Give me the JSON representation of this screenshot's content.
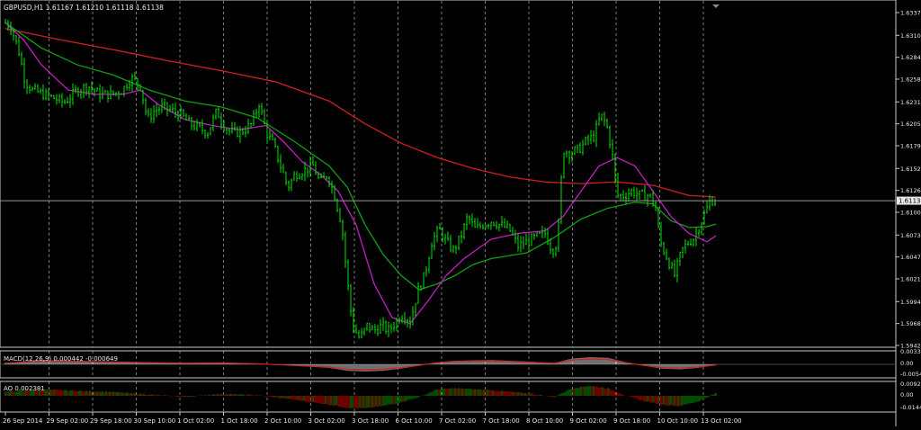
{
  "symbol_header": "GBPUSD,H1  1.61167 1.61210 1.61118 1.61138",
  "price": {
    "current": "1.61138",
    "ticks": [
      {
        "value": 1.6337,
        "label": "1.63370"
      },
      {
        "value": 1.631,
        "label": "1.63100"
      },
      {
        "value": 1.6284,
        "label": "1.62845"
      },
      {
        "value": 1.6258,
        "label": "1.62580"
      },
      {
        "value": 1.6231,
        "label": "1.62310"
      },
      {
        "value": 1.6205,
        "label": "1.62055"
      },
      {
        "value": 1.6179,
        "label": "1.61790"
      },
      {
        "value": 1.6152,
        "label": "1.61525"
      },
      {
        "value": 1.6126,
        "label": "1.61265"
      },
      {
        "value": 1.61,
        "label": "1.61000"
      },
      {
        "value": 1.6073,
        "label": "1.60735"
      },
      {
        "value": 1.6047,
        "label": "1.60470"
      },
      {
        "value": 1.6021,
        "label": "1.60210"
      },
      {
        "value": 1.5994,
        "label": "1.59945"
      },
      {
        "value": 1.5968,
        "label": "1.59680"
      },
      {
        "value": 1.5942,
        "label": "1.59420"
      }
    ]
  },
  "macd": {
    "label": "MACD(12,26,9) 0.000442 -0.000649",
    "ticks": [
      "0.00338",
      "0.00",
      "-0.00546"
    ]
  },
  "ao": {
    "label": "AO 0.002381",
    "ticks": [
      "0.00924",
      "0.00",
      "-0.01449"
    ]
  },
  "time_labels": [
    "26 Sep 2014",
    "29 Sep 02:00",
    "29 Sep 18:00",
    "30 Sep 10:00",
    "1 Oct 02:00",
    "1 Oct 18:00",
    "2 Oct 10:00",
    "3 Oct 02:00",
    "3 Oct 18:00",
    "6 Oct 10:00",
    "7 Oct 02:00",
    "7 Oct 18:00",
    "8 Oct 10:00",
    "9 Oct 02:00",
    "9 Oct 18:00",
    "10 Oct 10:00",
    "13 Oct 02:00"
  ],
  "colors": {
    "background": "#000000",
    "grid": "#c8c8c8",
    "bull": "#00e000",
    "bear": "#00e000",
    "ma_slow": "#d02020",
    "ma_mid": "#10a010",
    "ma_fast": "#c020c0",
    "hist_pos": "#009900",
    "hist_neg": "#dd0000",
    "macd_hist": "#e0e0e0"
  },
  "path_points": [
    [
      0,
      1.6325
    ],
    [
      6,
      1.632
    ],
    [
      14,
      1.6295
    ],
    [
      22,
      1.6255
    ],
    [
      30,
      1.6245
    ],
    [
      42,
      1.624
    ],
    [
      55,
      1.6235
    ],
    [
      65,
      1.623
    ],
    [
      80,
      1.6245
    ],
    [
      92,
      1.625
    ],
    [
      104,
      1.624
    ],
    [
      118,
      1.624
    ],
    [
      130,
      1.6245
    ],
    [
      140,
      1.626
    ],
    [
      150,
      1.625
    ],
    [
      158,
      1.621
    ],
    [
      165,
      1.622
    ],
    [
      175,
      1.6225
    ],
    [
      186,
      1.622
    ],
    [
      196,
      1.6215
    ],
    [
      205,
      1.6205
    ],
    [
      215,
      1.62
    ],
    [
      225,
      1.6195
    ],
    [
      235,
      1.622
    ],
    [
      242,
      1.6205
    ],
    [
      250,
      1.6195
    ],
    [
      262,
      1.6195
    ],
    [
      274,
      1.6205
    ],
    [
      282,
      1.623
    ],
    [
      290,
      1.6195
    ],
    [
      298,
      1.618
    ],
    [
      306,
      1.6155
    ],
    [
      314,
      1.613
    ],
    [
      322,
      1.6145
    ],
    [
      332,
      1.615
    ],
    [
      342,
      1.6155
    ],
    [
      350,
      1.6135
    ],
    [
      358,
      1.6145
    ],
    [
      366,
      1.612
    ],
    [
      374,
      1.6085
    ],
    [
      380,
      1.602
    ],
    [
      386,
      1.5965
    ],
    [
      394,
      1.595
    ],
    [
      402,
      1.5965
    ],
    [
      410,
      1.596
    ],
    [
      418,
      1.5965
    ],
    [
      426,
      1.596
    ],
    [
      434,
      1.597
    ],
    [
      442,
      1.598
    ],
    [
      450,
      1.597
    ],
    [
      458,
      1.6005
    ],
    [
      466,
      1.6025
    ],
    [
      474,
      1.6065
    ],
    [
      482,
      1.608
    ],
    [
      490,
      1.6065
    ],
    [
      498,
      1.6055
    ],
    [
      506,
      1.607
    ],
    [
      514,
      1.6095
    ],
    [
      522,
      1.608
    ],
    [
      530,
      1.6085
    ],
    [
      540,
      1.609
    ],
    [
      550,
      1.6085
    ],
    [
      560,
      1.608
    ],
    [
      570,
      1.606
    ],
    [
      580,
      1.6065
    ],
    [
      590,
      1.607
    ],
    [
      600,
      1.6075
    ],
    [
      608,
      1.6055
    ],
    [
      614,
      1.6065
    ],
    [
      620,
      1.6175
    ],
    [
      628,
      1.617
    ],
    [
      638,
      1.6175
    ],
    [
      646,
      1.6185
    ],
    [
      654,
      1.619
    ],
    [
      662,
      1.6215
    ],
    [
      668,
      1.6205
    ],
    [
      674,
      1.6175
    ],
    [
      680,
      1.612
    ],
    [
      688,
      1.612
    ],
    [
      696,
      1.6125
    ],
    [
      706,
      1.612
    ],
    [
      716,
      1.612
    ],
    [
      722,
      1.611
    ],
    [
      728,
      1.6065
    ],
    [
      736,
      1.6045
    ],
    [
      744,
      1.6025
    ],
    [
      752,
      1.6055
    ],
    [
      760,
      1.6065
    ],
    [
      766,
      1.607
    ],
    [
      772,
      1.6085
    ],
    [
      778,
      1.61
    ],
    [
      784,
      1.6115
    ],
    [
      790,
      1.6113
    ]
  ],
  "ma_slow_points": [
    [
      0,
      1.6318
    ],
    [
      60,
      1.6305
    ],
    [
      120,
      1.6293
    ],
    [
      180,
      1.628
    ],
    [
      240,
      1.6268
    ],
    [
      300,
      1.6255
    ],
    [
      360,
      1.6232
    ],
    [
      400,
      1.6205
    ],
    [
      440,
      1.6182
    ],
    [
      480,
      1.6165
    ],
    [
      520,
      1.6152
    ],
    [
      560,
      1.6142
    ],
    [
      600,
      1.6136
    ],
    [
      640,
      1.6134
    ],
    [
      680,
      1.6136
    ],
    [
      720,
      1.6132
    ],
    [
      760,
      1.612
    ],
    [
      790,
      1.6118
    ]
  ],
  "ma_mid_points": [
    [
      0,
      1.6325
    ],
    [
      40,
      1.6295
    ],
    [
      80,
      1.6275
    ],
    [
      120,
      1.6263
    ],
    [
      160,
      1.6245
    ],
    [
      200,
      1.6232
    ],
    [
      240,
      1.6225
    ],
    [
      280,
      1.6212
    ],
    [
      320,
      1.6185
    ],
    [
      360,
      1.6155
    ],
    [
      380,
      1.613
    ],
    [
      400,
      1.6085
    ],
    [
      420,
      1.605
    ],
    [
      440,
      1.6025
    ],
    [
      460,
      1.6008
    ],
    [
      480,
      1.6015
    ],
    [
      500,
      1.6025
    ],
    [
      520,
      1.6038
    ],
    [
      540,
      1.6045
    ],
    [
      580,
      1.6052
    ],
    [
      610,
      1.607
    ],
    [
      640,
      1.6092
    ],
    [
      670,
      1.6105
    ],
    [
      700,
      1.6112
    ],
    [
      720,
      1.611
    ],
    [
      740,
      1.609
    ],
    [
      760,
      1.6082
    ],
    [
      780,
      1.6083
    ],
    [
      790,
      1.6086
    ]
  ],
  "ma_fast_points": [
    [
      0,
      1.6325
    ],
    [
      20,
      1.6305
    ],
    [
      40,
      1.6275
    ],
    [
      70,
      1.6245
    ],
    [
      100,
      1.624
    ],
    [
      130,
      1.624
    ],
    [
      150,
      1.6245
    ],
    [
      170,
      1.6228
    ],
    [
      200,
      1.621
    ],
    [
      230,
      1.6203
    ],
    [
      260,
      1.6198
    ],
    [
      290,
      1.6203
    ],
    [
      310,
      1.6183
    ],
    [
      330,
      1.616
    ],
    [
      350,
      1.6145
    ],
    [
      370,
      1.6125
    ],
    [
      390,
      1.6085
    ],
    [
      410,
      1.6015
    ],
    [
      430,
      1.5975
    ],
    [
      450,
      1.5968
    ],
    [
      470,
      1.5995
    ],
    [
      490,
      1.6025
    ],
    [
      510,
      1.6045
    ],
    [
      540,
      1.6068
    ],
    [
      570,
      1.6075
    ],
    [
      600,
      1.6078
    ],
    [
      620,
      1.6095
    ],
    [
      640,
      1.6125
    ],
    [
      660,
      1.6155
    ],
    [
      680,
      1.6165
    ],
    [
      700,
      1.6155
    ],
    [
      720,
      1.6125
    ],
    [
      740,
      1.6095
    ],
    [
      760,
      1.6075
    ],
    [
      780,
      1.6065
    ],
    [
      790,
      1.6072
    ]
  ],
  "macd_series": [
    [
      0,
      0.2
    ],
    [
      40,
      0.6
    ],
    [
      80,
      0.5
    ],
    [
      120,
      0.4
    ],
    [
      160,
      0.3
    ],
    [
      200,
      0.2
    ],
    [
      240,
      0.25
    ],
    [
      280,
      0.1
    ],
    [
      320,
      -0.2
    ],
    [
      360,
      -0.5
    ],
    [
      380,
      -0.9
    ],
    [
      400,
      -1.0
    ],
    [
      420,
      -0.9
    ],
    [
      440,
      -0.6
    ],
    [
      460,
      -0.2
    ],
    [
      480,
      0.3
    ],
    [
      500,
      0.5
    ],
    [
      540,
      0.6
    ],
    [
      580,
      0.4
    ],
    [
      610,
      0.2
    ],
    [
      630,
      0.8
    ],
    [
      650,
      1.0
    ],
    [
      670,
      0.9
    ],
    [
      690,
      0.3
    ],
    [
      710,
      -0.2
    ],
    [
      730,
      -0.6
    ],
    [
      750,
      -0.7
    ],
    [
      770,
      -0.5
    ],
    [
      790,
      -0.1
    ]
  ],
  "ao_series": [
    [
      0,
      0.3
    ],
    [
      40,
      0.5
    ],
    [
      80,
      0.4
    ],
    [
      120,
      0.3
    ],
    [
      160,
      0.1
    ],
    [
      200,
      -0.1
    ],
    [
      240,
      0.15
    ],
    [
      280,
      0.05
    ],
    [
      320,
      -0.3
    ],
    [
      360,
      -0.7
    ],
    [
      380,
      -0.95
    ],
    [
      400,
      -1.0
    ],
    [
      420,
      -0.8
    ],
    [
      440,
      -0.5
    ],
    [
      460,
      -0.1
    ],
    [
      480,
      0.5
    ],
    [
      500,
      0.6
    ],
    [
      540,
      0.45
    ],
    [
      580,
      0.2
    ],
    [
      610,
      -0.1
    ],
    [
      630,
      0.6
    ],
    [
      650,
      0.8
    ],
    [
      670,
      0.6
    ],
    [
      690,
      0.0
    ],
    [
      710,
      -0.4
    ],
    [
      730,
      -0.7
    ],
    [
      750,
      -0.8
    ],
    [
      770,
      -0.45
    ],
    [
      790,
      0.2
    ]
  ]
}
